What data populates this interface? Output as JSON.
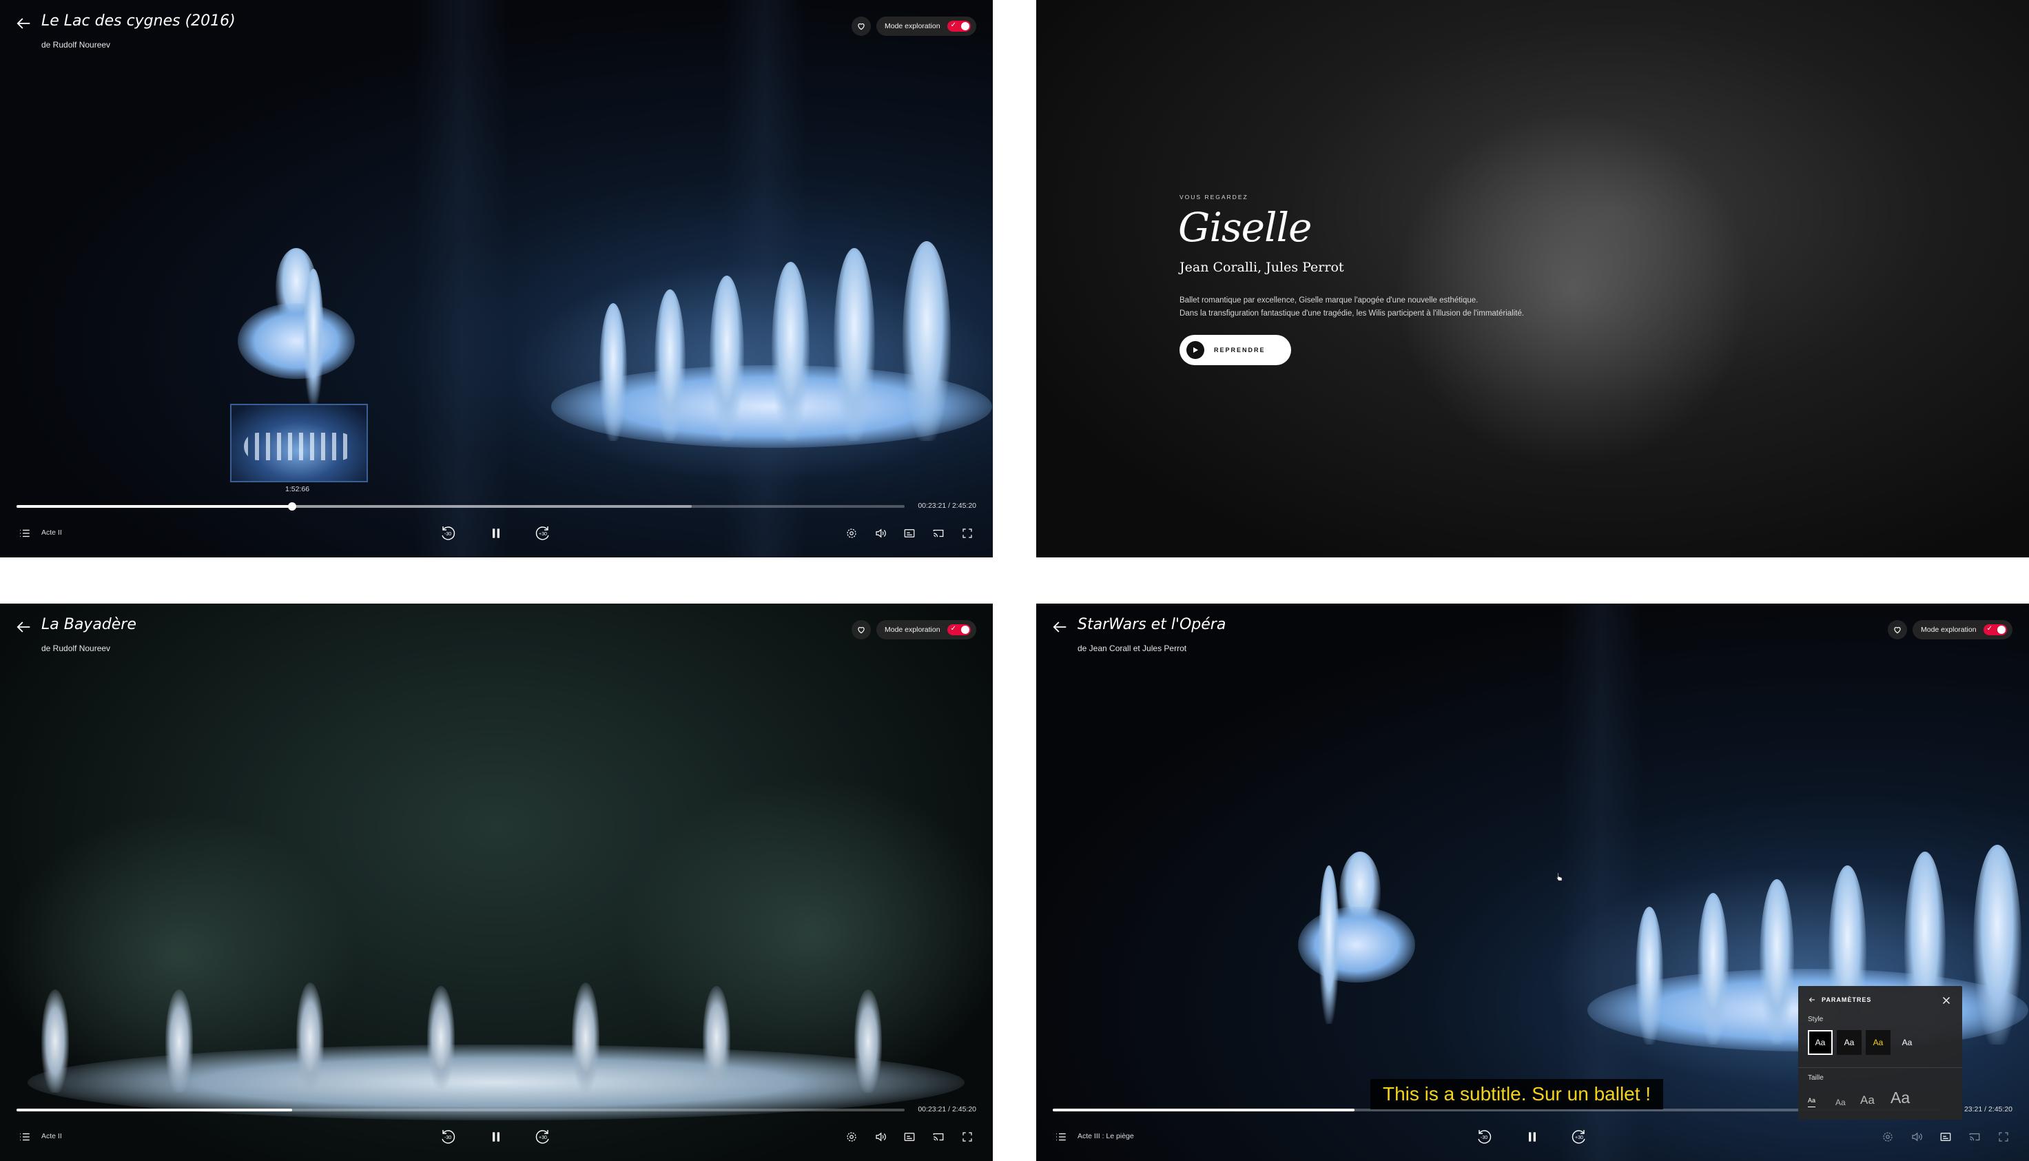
{
  "players": [
    {
      "title": "Le Lac des cygnes (2016)",
      "author": "de Rudolf Noureev",
      "explore_label": "Mode exploration",
      "time": "00:23:21 / 2:45:20",
      "chapter": "Acte II",
      "progress_fraction": 0.31,
      "buffer_fraction": 0.76,
      "preview_time": "1:52:66",
      "skip_back": "-30",
      "skip_forward": "+30"
    },
    {
      "title": "La Bayadère",
      "author": "de Rudolf Noureev",
      "explore_label": "Mode exploration",
      "time": "00:23:21 / 2:45:20",
      "chapter": "Acte II",
      "progress_fraction": 0.31,
      "buffer_fraction": 0.31,
      "skip_back": "-30",
      "skip_forward": "+30"
    },
    {
      "title": "StarWars et l'Opéra",
      "author": "de Jean Corall et Jules Perrot",
      "explore_label": "Mode exploration",
      "time": "23:21 / 2:45:20",
      "chapter": "Acte III : Le piège",
      "progress_fraction": 0.34,
      "buffer_fraction": 0.34,
      "skip_back": "-30",
      "skip_forward": "+30",
      "subtitle": "This is a subtitle. Sur un ballet !",
      "settings": {
        "title": "PARAMÈTRES",
        "style_label": "Style",
        "style_options": [
          "Aa",
          "Aa",
          "Aa",
          "Aa"
        ],
        "size_label": "Taille",
        "size_options": [
          "Aa",
          "Aa",
          "Aa",
          "Aa"
        ],
        "selected_style": 0,
        "selected_size": 0
      }
    }
  ],
  "giselle": {
    "kicker": "VOUS REGARDEZ",
    "title": "Giselle",
    "authors": "Jean Coralli, Jules Perrot",
    "description": [
      "Ballet romantique par excellence, Giselle marque l'apogée d'une nouvelle esthétique.",
      "Dans la transfiguration fantastique d'une tragédie, les Wilis participent à l'illusion de l'immatérialité."
    ],
    "resume_label": "REPRENDRE"
  },
  "colors": {
    "toggle_on": "#e30b3b",
    "subtitle_text": "#f5d21a",
    "panel_bg": "#262628"
  }
}
